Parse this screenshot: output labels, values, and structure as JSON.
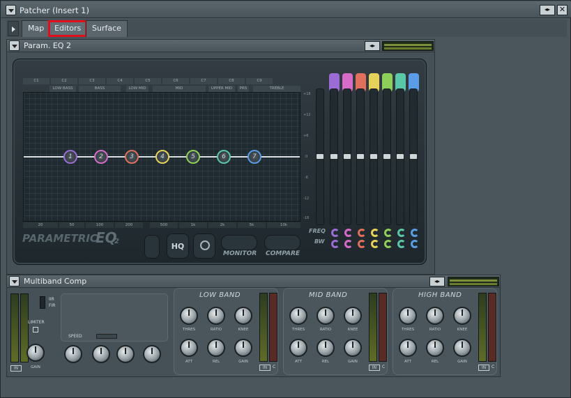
{
  "window": {
    "title": "Patcher (Insert 1)",
    "btn_lr": "◂▸",
    "btn_close": "✕"
  },
  "tabs": [
    {
      "label": "Map"
    },
    {
      "label": "Editors"
    },
    {
      "label": "Surface"
    }
  ],
  "eq_panel": {
    "title": "Param. EQ 2",
    "brand": "PARAMETRIC",
    "brand2": "EQ",
    "brand_sub": "2",
    "band_headers": [
      "C1",
      "C2",
      "C3",
      "C4",
      "C5",
      "C6",
      "C7",
      "C8",
      "C9"
    ],
    "band_names": [
      "LOW BASS",
      "BASS",
      "LOW MID",
      "MID",
      "UPPER MID",
      "PRS",
      "TREBLE"
    ],
    "db_labels": [
      "+18",
      "+12",
      "+6",
      "0",
      "-6",
      "-12",
      "-18"
    ],
    "freq_labels": [
      "20",
      "50",
      "100",
      "200",
      "500",
      "1k",
      "2k",
      "5k",
      "10k"
    ],
    "nodes": [
      "1",
      "2",
      "3",
      "4",
      "5",
      "6",
      "7"
    ],
    "node_colors": [
      "#9b6bd6",
      "#d66bc8",
      "#e0705c",
      "#e6d25a",
      "#8cd05a",
      "#5ac8a8",
      "#5a9ce6"
    ],
    "freq_label": "FREQ",
    "bw_label": "BW",
    "hq_label": "HQ",
    "monitor_label": "MONITOR",
    "compare_label": "COMPARE"
  },
  "mb_panel": {
    "title": "Multiband Comp",
    "iir": "IIR",
    "fir": "FIR",
    "limiter": "LIMITER",
    "speed": "SPEED",
    "gain": "GAIN",
    "in": "IN",
    "c": "C",
    "bands": [
      {
        "name": "LOW BAND"
      },
      {
        "name": "MID BAND"
      },
      {
        "name": "HIGH BAND"
      }
    ],
    "knob_labels": [
      "THRES",
      "RATIO",
      "KNEE",
      "ATT",
      "REL",
      "GAIN"
    ]
  }
}
